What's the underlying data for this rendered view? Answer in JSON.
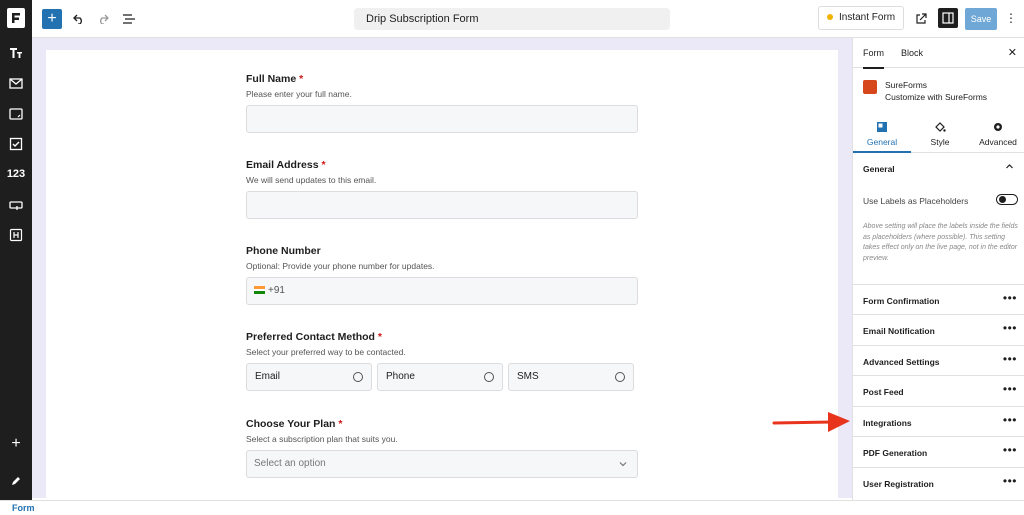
{
  "window": {
    "document_title": "Drip Subscription Form"
  },
  "toolbar": {
    "instant_form_label": "Instant Form",
    "save_label": "Save"
  },
  "left_rail": {
    "items": [
      {
        "icon": "text-size-icon"
      },
      {
        "icon": "envelope-icon"
      },
      {
        "icon": "textarea-icon"
      },
      {
        "icon": "checkbox-icon"
      },
      {
        "label": "123",
        "icon": "number-icon"
      },
      {
        "icon": "link-icon"
      },
      {
        "icon": "heading-icon"
      }
    ]
  },
  "form": {
    "fields": [
      {
        "label": "Full Name",
        "required": "*",
        "help": "Please enter your full name.",
        "value": ""
      },
      {
        "label": "Email Address",
        "required": "*",
        "help": "We will send updates to this email.",
        "value": ""
      },
      {
        "label": "Phone Number",
        "required": "",
        "help": "Optional: Provide your phone number for updates.",
        "value": "+91"
      },
      {
        "label": "Preferred Contact Method",
        "required": "*",
        "help": "Select your preferred way to be contacted.",
        "options": [
          "Email",
          "Phone",
          "SMS"
        ]
      },
      {
        "label": "Choose Your Plan",
        "required": "*",
        "help": "Select a subscription plan that suits you.",
        "placeholder": "Select an option"
      }
    ]
  },
  "panel": {
    "tabs": [
      "Form",
      "Block"
    ],
    "brand": {
      "name": "SureForms",
      "subtitle": "Customize with SureForms"
    },
    "sub_tabs": [
      "General",
      "Style",
      "Advanced"
    ],
    "section_title": "General",
    "toggle_label": "Use Labels as Placeholders",
    "help_note": "Above setting will place the labels inside the fields as placeholders (where possible). This setting takes effect only on the live page, not in the editor preview.",
    "rows": [
      "Form Confirmation",
      "Email Notification",
      "Advanced Settings",
      "Post Feed",
      "Integrations",
      "PDF Generation",
      "User Registration"
    ],
    "dots": "•••",
    "close": "✕"
  },
  "footer": {
    "breadcrumb": "Form"
  },
  "colors": {
    "accent": "#2271b1",
    "arrow": "#e8341c",
    "brand": "#d6471c"
  }
}
